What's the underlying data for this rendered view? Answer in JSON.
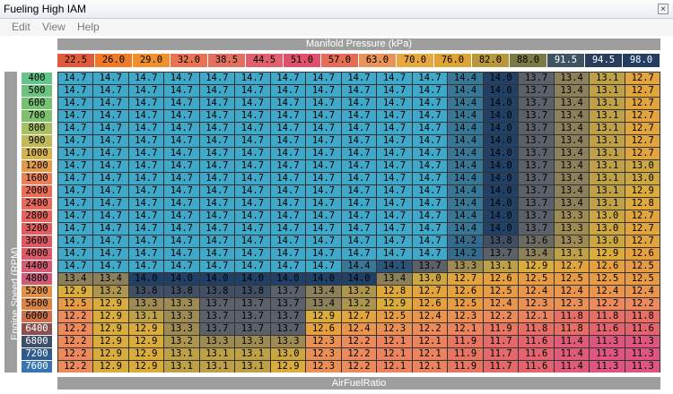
{
  "window": {
    "title": "Fueling High IAM",
    "close_glyph": "×"
  },
  "menu": [
    "Edit",
    "View",
    "Help"
  ],
  "x_axis": {
    "label": "Manifold Pressure (kPa)",
    "values": [
      "22.5",
      "26.0",
      "29.0",
      "32.0",
      "38.5",
      "44.5",
      "51.0",
      "57.0",
      "63.0",
      "70.0",
      "76.0",
      "82.0",
      "88.0",
      "91.5",
      "94.5",
      "98.0"
    ],
    "colors": [
      "#e25a3c",
      "#f07a26",
      "#f0902c",
      "#e87252",
      "#e27060",
      "#e2606e",
      "#e0506e",
      "#e56c55",
      "#e8935a",
      "#e8a840",
      "#dca434",
      "#b8983a",
      "#7a7a48",
      "#3e5462",
      "#2a3c5c",
      "#243e62"
    ]
  },
  "y_axis": {
    "label": "Engine Speed (RPM)",
    "values": [
      "400",
      "500",
      "600",
      "700",
      "800",
      "900",
      "1000",
      "1200",
      "1600",
      "2000",
      "2400",
      "2800",
      "3200",
      "3600",
      "4000",
      "4400",
      "4800",
      "5200",
      "5600",
      "6000",
      "6400",
      "6800",
      "7200",
      "7600"
    ],
    "colors": [
      "#64c48a",
      "#6cc27e",
      "#76c073",
      "#7ec06e",
      "#a8c064",
      "#c0b85c",
      "#d4b452",
      "#e29a4c",
      "#e8805a",
      "#e86e58",
      "#e66a5c",
      "#e2645c",
      "#e05e60",
      "#de5a62",
      "#dc5a68",
      "#d45c72",
      "#cc5c78",
      "#e0924a",
      "#d88448",
      "#cc704a",
      "#8a5050",
      "#3e4e6a",
      "#2e5a8c",
      "#3a74b0"
    ]
  },
  "table": {
    "name": "AirFuelRatio",
    "rows": [
      [
        "14.7",
        "14.7",
        "14.7",
        "14.7",
        "14.7",
        "14.7",
        "14.7",
        "14.7",
        "14.7",
        "14.7",
        "14.7",
        "14.4",
        "14.0",
        "13.7",
        "13.4",
        "13.1",
        "12.7"
      ],
      [
        "14.7",
        "14.7",
        "14.7",
        "14.7",
        "14.7",
        "14.7",
        "14.7",
        "14.7",
        "14.7",
        "14.7",
        "14.7",
        "14.4",
        "14.0",
        "13.7",
        "13.4",
        "13.1",
        "12.7"
      ],
      [
        "14.7",
        "14.7",
        "14.7",
        "14.7",
        "14.7",
        "14.7",
        "14.7",
        "14.7",
        "14.7",
        "14.7",
        "14.7",
        "14.4",
        "14.0",
        "13.7",
        "13.4",
        "13.1",
        "12.7"
      ],
      [
        "14.7",
        "14.7",
        "14.7",
        "14.7",
        "14.7",
        "14.7",
        "14.7",
        "14.7",
        "14.7",
        "14.7",
        "14.7",
        "14.4",
        "14.0",
        "13.7",
        "13.4",
        "13.1",
        "12.7"
      ],
      [
        "14.7",
        "14.7",
        "14.7",
        "14.7",
        "14.7",
        "14.7",
        "14.7",
        "14.7",
        "14.7",
        "14.7",
        "14.7",
        "14.4",
        "14.0",
        "13.7",
        "13.4",
        "13.1",
        "12.7"
      ],
      [
        "14.7",
        "14.7",
        "14.7",
        "14.7",
        "14.7",
        "14.7",
        "14.7",
        "14.7",
        "14.7",
        "14.7",
        "14.7",
        "14.4",
        "14.0",
        "13.7",
        "13.4",
        "13.1",
        "12.7"
      ],
      [
        "14.7",
        "14.7",
        "14.7",
        "14.7",
        "14.7",
        "14.7",
        "14.7",
        "14.7",
        "14.7",
        "14.7",
        "14.7",
        "14.4",
        "14.0",
        "13.7",
        "13.4",
        "13.1",
        "12.7"
      ],
      [
        "14.7",
        "14.7",
        "14.7",
        "14.7",
        "14.7",
        "14.7",
        "14.7",
        "14.7",
        "14.7",
        "14.7",
        "14.7",
        "14.4",
        "14.0",
        "13.7",
        "13.4",
        "13.1",
        "13.0"
      ],
      [
        "14.7",
        "14.7",
        "14.7",
        "14.7",
        "14.7",
        "14.7",
        "14.7",
        "14.7",
        "14.7",
        "14.7",
        "14.7",
        "14.4",
        "14.0",
        "13.7",
        "13.4",
        "13.1",
        "13.0"
      ],
      [
        "14.7",
        "14.7",
        "14.7",
        "14.7",
        "14.7",
        "14.7",
        "14.7",
        "14.7",
        "14.7",
        "14.7",
        "14.7",
        "14.4",
        "14.0",
        "13.7",
        "13.4",
        "13.1",
        "12.9"
      ],
      [
        "14.7",
        "14.7",
        "14.7",
        "14.7",
        "14.7",
        "14.7",
        "14.7",
        "14.7",
        "14.7",
        "14.7",
        "14.7",
        "14.4",
        "14.0",
        "13.7",
        "13.4",
        "13.1",
        "12.8"
      ],
      [
        "14.7",
        "14.7",
        "14.7",
        "14.7",
        "14.7",
        "14.7",
        "14.7",
        "14.7",
        "14.7",
        "14.7",
        "14.7",
        "14.4",
        "14.0",
        "13.7",
        "13.3",
        "13.0",
        "12.7"
      ],
      [
        "14.7",
        "14.7",
        "14.7",
        "14.7",
        "14.7",
        "14.7",
        "14.7",
        "14.7",
        "14.7",
        "14.7",
        "14.7",
        "14.4",
        "14.0",
        "13.7",
        "13.3",
        "13.0",
        "12.7"
      ],
      [
        "14.7",
        "14.7",
        "14.7",
        "14.7",
        "14.7",
        "14.7",
        "14.7",
        "14.7",
        "14.7",
        "14.7",
        "14.7",
        "14.2",
        "13.8",
        "13.6",
        "13.3",
        "13.0",
        "12.7"
      ],
      [
        "14.7",
        "14.7",
        "14.7",
        "14.7",
        "14.7",
        "14.7",
        "14.7",
        "14.7",
        "14.7",
        "14.7",
        "14.7",
        "14.2",
        "13.7",
        "13.4",
        "13.1",
        "12.9",
        "12.6"
      ],
      [
        "14.7",
        "14.7",
        "14.7",
        "14.7",
        "14.7",
        "14.7",
        "14.7",
        "14.7",
        "14.4",
        "14.1",
        "13.7",
        "13.3",
        "13.1",
        "12.9",
        "12.7",
        "12.6",
        "12.5"
      ],
      [
        "13.4",
        "13.4",
        "14.0",
        "14.0",
        "14.0",
        "14.0",
        "14.0",
        "14.0",
        "14.0",
        "13.4",
        "13.0",
        "12.7",
        "12.6",
        "12.5",
        "12.5",
        "12.5",
        "12.5"
      ],
      [
        "12.9",
        "13.2",
        "13.8",
        "13.8",
        "13.8",
        "13.8",
        "13.7",
        "13.4",
        "13.2",
        "12.8",
        "12.7",
        "12.6",
        "12.5",
        "12.4",
        "12.4",
        "12.4",
        "12.4"
      ],
      [
        "12.5",
        "12.9",
        "13.3",
        "13.3",
        "13.7",
        "13.7",
        "13.7",
        "13.4",
        "13.2",
        "12.9",
        "12.6",
        "12.5",
        "12.4",
        "12.3",
        "12.3",
        "12.2",
        "12.2"
      ],
      [
        "12.2",
        "12.9",
        "13.1",
        "13.3",
        "13.7",
        "13.7",
        "13.7",
        "12.9",
        "12.7",
        "12.5",
        "12.4",
        "12.3",
        "12.2",
        "12.1",
        "11.8",
        "11.8",
        "11.8"
      ],
      [
        "12.2",
        "12.9",
        "12.9",
        "13.3",
        "13.7",
        "13.7",
        "13.7",
        "12.6",
        "12.4",
        "12.3",
        "12.2",
        "12.1",
        "11.9",
        "11.8",
        "11.8",
        "11.6",
        "11.6"
      ],
      [
        "12.2",
        "12.9",
        "12.9",
        "13.2",
        "13.3",
        "13.3",
        "13.3",
        "12.3",
        "12.2",
        "12.1",
        "12.1",
        "11.9",
        "11.7",
        "11.6",
        "11.4",
        "11.3",
        "11.3"
      ],
      [
        "12.2",
        "12.9",
        "12.9",
        "13.1",
        "13.1",
        "13.1",
        "13.0",
        "12.3",
        "12.2",
        "12.1",
        "12.1",
        "11.9",
        "11.7",
        "11.6",
        "11.4",
        "11.3",
        "11.3"
      ],
      [
        "12.2",
        "12.9",
        "12.9",
        "13.1",
        "13.1",
        "13.1",
        "12.9",
        "12.3",
        "12.2",
        "12.1",
        "12.1",
        "11.9",
        "11.7",
        "11.6",
        "11.4",
        "11.3",
        "11.3"
      ]
    ]
  }
}
